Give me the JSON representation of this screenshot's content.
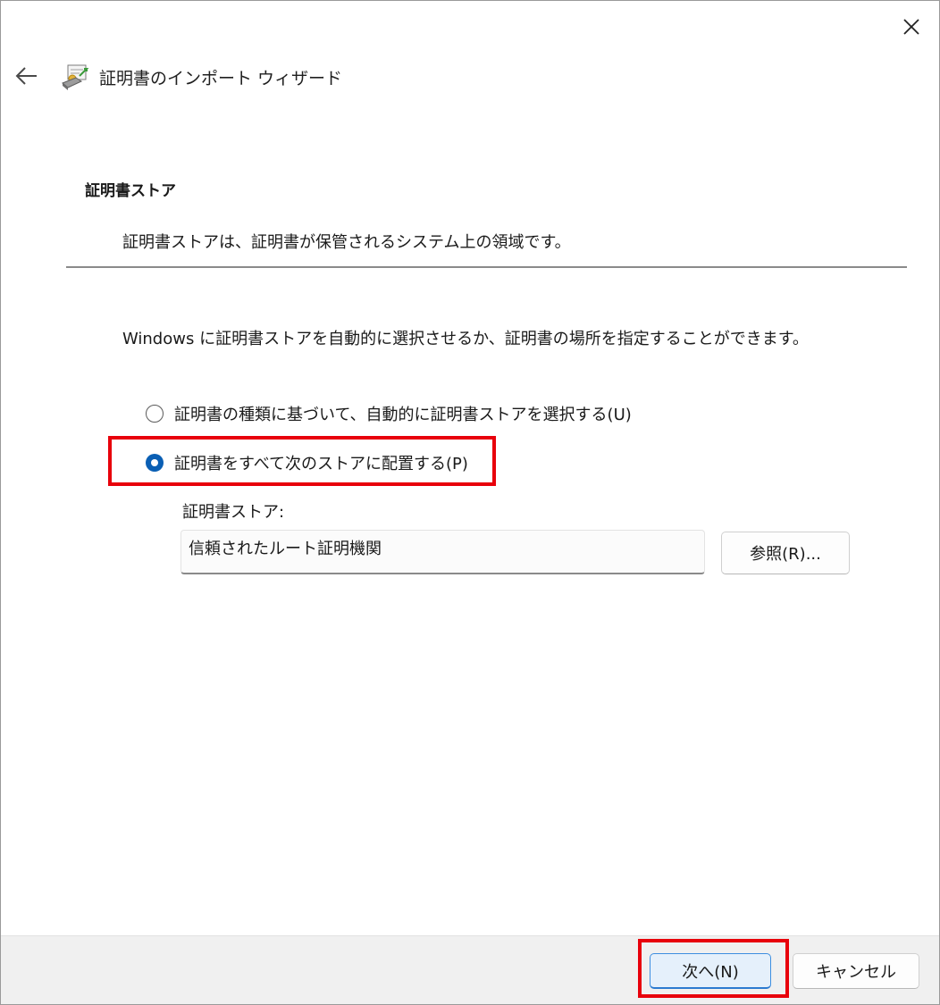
{
  "window": {
    "title": "証明書のインポート ウィザード",
    "close_icon": "close-icon",
    "back_icon": "back-arrow-icon",
    "wizard_icon": "certificate-import-icon"
  },
  "header": {
    "section_title": "証明書ストア",
    "section_description": "証明書ストアは、証明書が保管されるシステム上の領域です。"
  },
  "body": {
    "intro": "Windows に証明書ストアを自動的に選択させるか、証明書の場所を指定することができます。",
    "options": [
      {
        "label": "証明書の種類に基づいて、自動的に証明書ストアを選択する(U)",
        "selected": false
      },
      {
        "label": "証明書をすべて次のストアに配置する(P)",
        "selected": true
      }
    ],
    "store_label": "証明書ストア:",
    "store_value": "信頼されたルート証明機関",
    "browse_button": "参照(R)..."
  },
  "footer": {
    "next_button": "次へ(N)",
    "cancel_button": "キャンセル"
  },
  "colors": {
    "highlight": "#e8000b",
    "radio_accent": "#0a5fb4",
    "primary_button_border": "#3d8ee0"
  }
}
